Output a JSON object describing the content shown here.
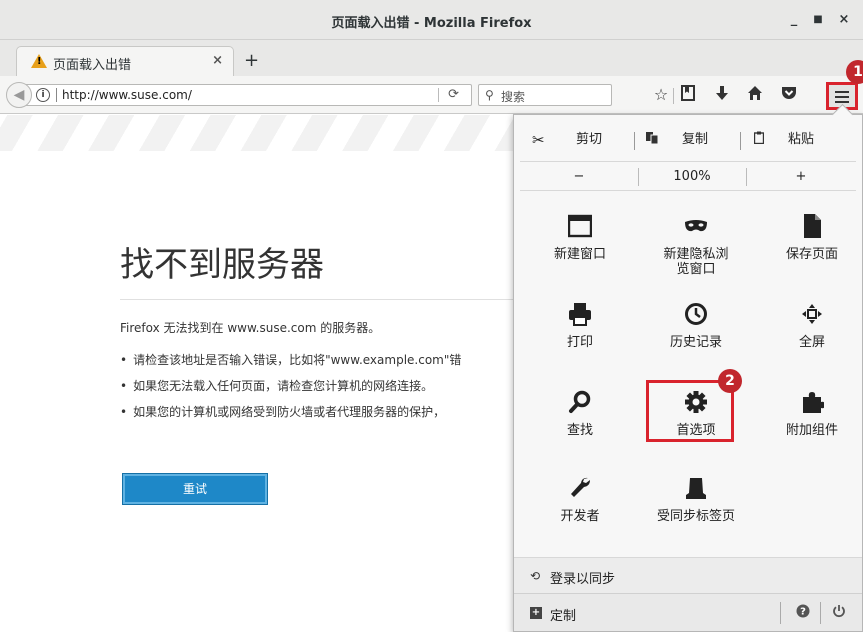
{
  "window": {
    "title": "页面载入出错 - Mozilla Firefox",
    "minimize": "_",
    "maximize": "■",
    "close": "×"
  },
  "tab": {
    "title": "页面载入出错",
    "close": "×",
    "new_tab": "+"
  },
  "nav": {
    "url": "http://www.suse.com/",
    "search_placeholder": "搜索"
  },
  "page": {
    "title": "找不到服务器",
    "lead": "Firefox 无法找到在 www.suse.com 的服务器。",
    "bullets": [
      "请检查该地址是否输入错误，比如将\"www.example.com\"错",
      "如果您无法载入任何页面，请检查您计算机的网络连接。",
      "如果您的计算机或网络受到防火墙或者代理服务器的保护，"
    ],
    "retry": "重试"
  },
  "menu": {
    "cut": "剪切",
    "copy": "复制",
    "paste": "粘贴",
    "zoom_out": "−",
    "zoom_level": "100%",
    "zoom_in": "+",
    "items": [
      {
        "label": "新建窗口",
        "icon": "new-window-icon"
      },
      {
        "label": "新建隐私浏览窗口",
        "icon": "private-mask-icon"
      },
      {
        "label": "保存页面",
        "icon": "save-page-icon"
      },
      {
        "label": "打印",
        "icon": "printer-icon"
      },
      {
        "label": "历史记录",
        "icon": "history-clock-icon"
      },
      {
        "label": "全屏",
        "icon": "fullscreen-icon"
      },
      {
        "label": "查找",
        "icon": "find-magnifier-icon"
      },
      {
        "label": "首选项",
        "icon": "gear-icon"
      },
      {
        "label": "附加组件",
        "icon": "puzzle-piece-icon"
      },
      {
        "label": "开发者",
        "icon": "wrench-icon"
      },
      {
        "label": "受同步标签页",
        "icon": "synced-tabs-icon"
      }
    ],
    "sync": "登录以同步",
    "customize": "定制"
  },
  "annotations": {
    "badge1": "1",
    "badge2": "2"
  },
  "colors": {
    "highlight": "#d9232d",
    "retry_button": "#1e88c8",
    "badge": "#c1272d"
  }
}
